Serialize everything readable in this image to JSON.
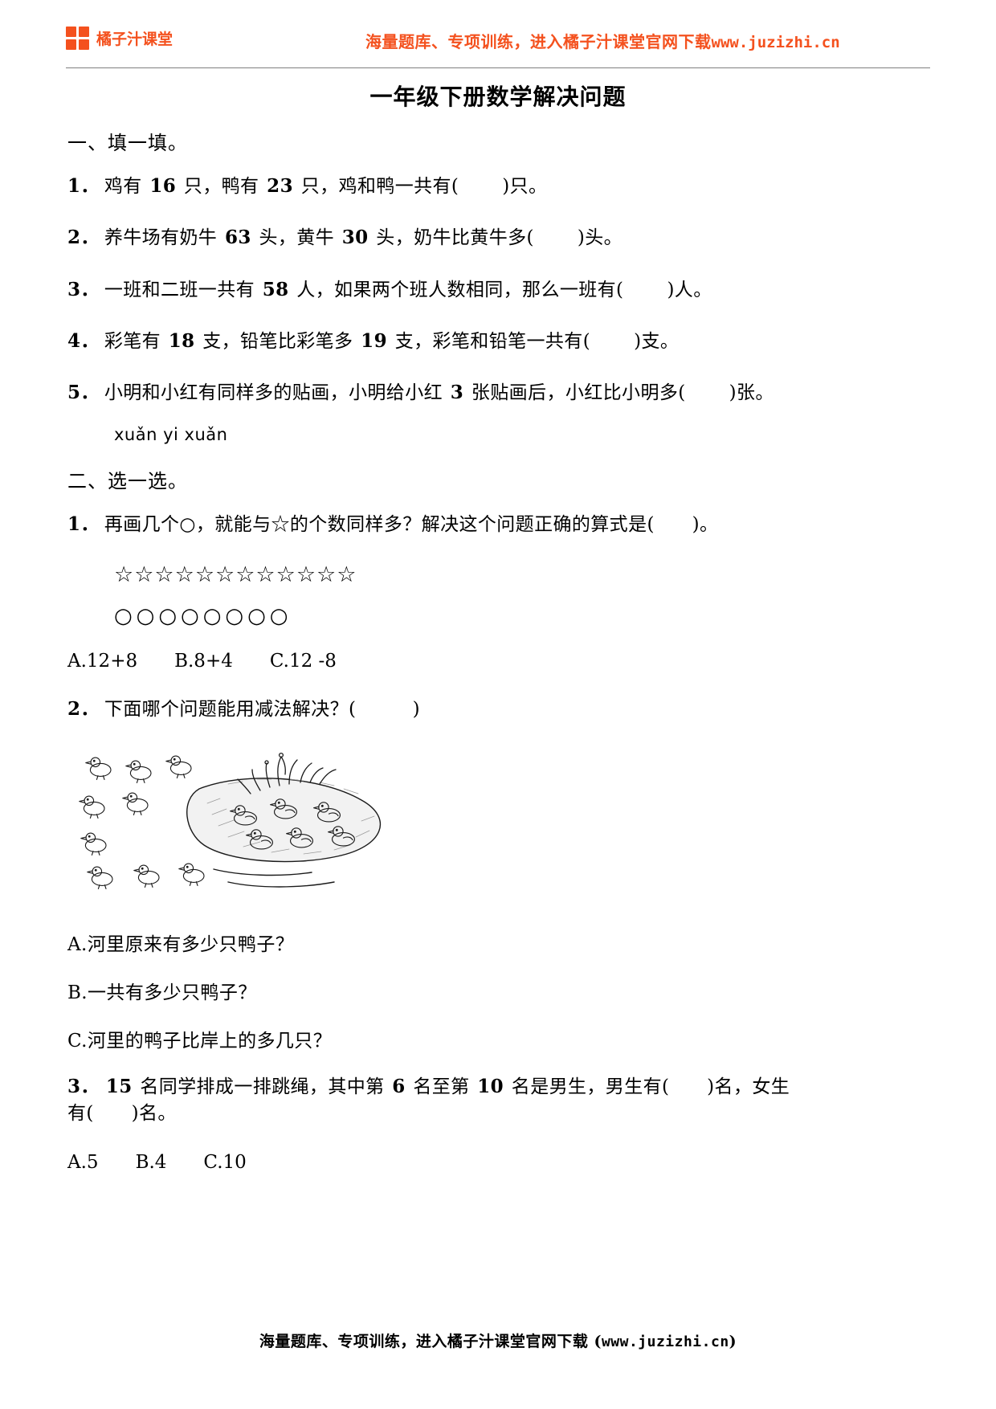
{
  "header": {
    "brand_name": "橘子汁课堂",
    "logo_icon": "four-squares-logo-icon",
    "promo_text": "海量题库、专项训练，进入橘子汁课堂官网下载",
    "promo_url": "www.juzizhi.cn",
    "accent_color": "#f4511e"
  },
  "document": {
    "title": "一年级下册数学解决问题"
  },
  "section_one": {
    "heading": "一、填一填。",
    "items": [
      {
        "num": "1．",
        "text_before": "鸡有 ",
        "n1": "16",
        "text_mid1": " 只，鸭有 ",
        "n2": "23",
        "text_mid2": " 只，鸡和鸭一共有(",
        "text_after": ")只。"
      },
      {
        "num": "2．",
        "text_before": "养牛场有奶牛 ",
        "n1": "63",
        "text_mid1": " 头，黄牛 ",
        "n2": "30",
        "text_mid2": " 头，奶牛比黄牛多(",
        "text_after": ")头。"
      },
      {
        "num": "3．",
        "text_before": "一班和二班一共有 ",
        "n1": "58",
        "text_mid1": " 人，如果两个班人数相同，那么一班有(",
        "n2": "",
        "text_mid2": "",
        "text_after": ")人。"
      },
      {
        "num": "4．",
        "text_before": "彩笔有 ",
        "n1": "18",
        "text_mid1": " 支，铅笔比彩笔多 ",
        "n2": "19",
        "text_mid2": " 支，彩笔和铅笔一共有(",
        "text_after": ")支。"
      },
      {
        "num": "5．",
        "text_before": "小明和小红有同样多的贴画，小明给小红 ",
        "n1": "3",
        "text_mid1": " 张贴画后，小红比小明多(",
        "n2": "",
        "text_mid2": "",
        "text_after": ")张。"
      }
    ],
    "pinyin_note": "xuǎn yi xuǎn"
  },
  "section_two": {
    "heading": "二、选一选。",
    "q1": {
      "num": "1．",
      "text": "再画几个○，就能与☆的个数同样多？解决这个问题正确的算式是(　　)。",
      "stars": "☆☆☆☆☆☆☆☆☆☆☆☆",
      "star_count": 12,
      "circles": "○○○○○○○○",
      "circle_count": 8,
      "options": [
        "A.12+8",
        "B.8+4",
        "C.12 -8"
      ]
    },
    "q2": {
      "num": "2．",
      "text": "下面哪个问题能用减法解决？(　　　)",
      "figure_name": "ducks-pond-illustration",
      "figure_alt": "岸上和河里的鸭子图",
      "choices": [
        "A.河里原来有多少只鸭子？",
        "B.一共有多少只鸭子？",
        "C.河里的鸭子比岸上的多几只？"
      ]
    },
    "q3": {
      "num": "3．",
      "text_before": "",
      "n1": "15",
      "text_mid1": " 名同学排成一排跳绳，其中第 ",
      "n2": "6",
      "text_mid2": " 名至第 ",
      "n3": "10",
      "text_mid3": " 名是男生，男生有(　　)名，女生",
      "text_line2": "有(　　)名。",
      "options": [
        "A.5",
        "B.4",
        "C.10"
      ]
    }
  },
  "footer": {
    "text_before": "海量题库、专项训练，进入橘子汁课堂官网下载 (",
    "url": "www.juzizhi.cn",
    "text_after": ")"
  }
}
